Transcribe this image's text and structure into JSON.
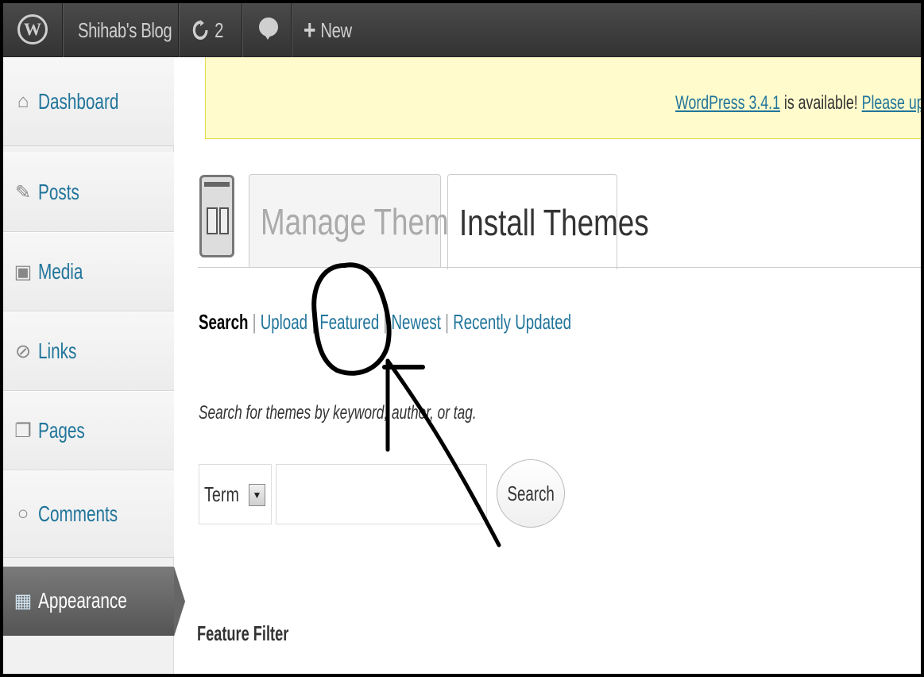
{
  "adminbar": {
    "site_name": "Shihab's Blog",
    "updates_count": "2",
    "new_label": "New",
    "icons": [
      "wordpress-logo-icon",
      "refresh-icon",
      "comment-bubble-icon",
      "plus-icon"
    ]
  },
  "sidebar": {
    "items": [
      {
        "label": "Dashboard",
        "icon": "dashboard-icon"
      },
      {
        "label": "Posts",
        "icon": "pushpin-icon"
      },
      {
        "label": "Media",
        "icon": "media-icon"
      },
      {
        "label": "Links",
        "icon": "paperclip-icon"
      },
      {
        "label": "Pages",
        "icon": "pages-icon"
      },
      {
        "label": "Comments",
        "icon": "comment-icon"
      },
      {
        "label": "Appearance",
        "icon": "appearance-icon",
        "active": true
      }
    ]
  },
  "notice": {
    "version_link": "WordPress 3.4.1",
    "text": " is available! ",
    "update_link": "Please up"
  },
  "tabs": {
    "manage": "Manage Themes",
    "install": "Install Themes"
  },
  "subsub": {
    "search": "Search",
    "upload": "Upload",
    "featured": "Featured",
    "newest": "Newest",
    "recently_updated": "Recently Updated",
    "separator": " | "
  },
  "search": {
    "help": "Search for themes by keyword, author, or tag.",
    "type_selected": "Term",
    "input_value": "",
    "button": "Search"
  },
  "feature_filter": "Feature Filter",
  "colors": {
    "link": "#21759b",
    "adminbar": "#464646",
    "notice_bg": "#fffbcc",
    "active_menu": "#6d6d6d"
  }
}
